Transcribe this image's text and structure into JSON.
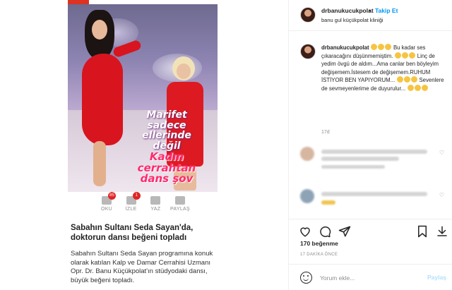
{
  "header": {
    "username": "drbanukucukpolat",
    "separator": "•",
    "follow_label": "Takip Et",
    "location": "banu gul küçükpolat kliniği",
    "more_icon": "more-dots-icon"
  },
  "caption": {
    "username": "drbanukucukpolat",
    "line1": "Bu kadar ses çıkaracağını düşünmemiştim.",
    "line2": "Linç de yedim övgü de aldım...Ama canlar ben böyleyim değişemem.İstesem de değişemem.RUHUM İSTİYOR BEN YAPIYORUM...",
    "line3": "Sevenlere de sevmeyenlerime de duyurulur...",
    "time": "17d"
  },
  "post_image": {
    "overlay_line1": "Marifet",
    "overlay_line2": "sadece",
    "overlay_line3": "ellerinde",
    "overlay_line4": "değil",
    "overlay_line5": "Kadın",
    "overlay_line6": "cerrahtan",
    "overlay_line7": "dans şov",
    "actions": [
      {
        "label": "OKU",
        "badge": "85",
        "icon": "comment-icon"
      },
      {
        "label": "İZLE",
        "badge": "1",
        "icon": "play-icon"
      },
      {
        "label": "YAZ",
        "badge": "",
        "icon": "edit-icon"
      },
      {
        "label": "PAYLAŞ",
        "badge": "",
        "icon": "share-icon"
      }
    ],
    "headline": "Sabahın Sultanı Seda Sayan'da, doktorun dansı beğeni topladı",
    "body": "Sabahın Sultanı Seda Sayan programına konuk olarak katılan Kalp ve Damar Cerrahisi Uzmanı Opr. Dr. Banu Küçükpolat'ın stüdyodaki dansı, büyük beğeni topladı."
  },
  "engagement": {
    "likes": "170 beğenme",
    "time": "17 DAKİKA ÖNCE"
  },
  "comment_box": {
    "placeholder": "Yorum ekle...",
    "post_label": "Paylaş"
  },
  "colors": {
    "accent": "#0095f6",
    "post_disabled": "#b2dffc",
    "dress_red": "#d8141e"
  }
}
